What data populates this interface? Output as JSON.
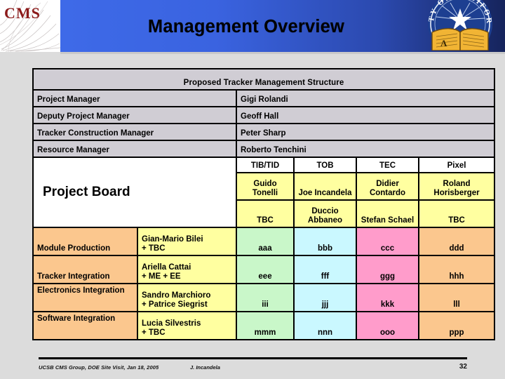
{
  "slide": {
    "title": "Management Overview",
    "logo_left": {
      "icon": "cms-detector-logo",
      "text": "CMS"
    },
    "logo_right": {
      "icon": "university-of-california-seal",
      "text": "TY OF CALIFOR"
    }
  },
  "colors": {
    "banner_start": "#3e6ae8",
    "banner_end": "#16245c",
    "background": "#dcdcdc",
    "cell_grey": "#d0cdd4",
    "cell_white": "#ffffff",
    "cell_yellow": "#ffffa0",
    "cell_orange": "#fbc78e",
    "cell_green": "#c9f7c9",
    "cell_cyan": "#caf8ff",
    "cell_pink": "#ff9ccb",
    "cms_red": "#8b1a1a"
  },
  "table": {
    "title": "Proposed Tracker Management Structure",
    "management_rows": [
      {
        "role": "Project Manager",
        "person": "Gigi Rolandi"
      },
      {
        "role": "Deputy Project Manager",
        "person": "Geoff Hall"
      },
      {
        "role": "Tracker Construction Manager",
        "person": "Peter Sharp"
      },
      {
        "role": "Resource Manager",
        "person": "Roberto Tenchini"
      }
    ],
    "subsystem_headers": [
      "TIB/TID",
      "TOB",
      "TEC",
      "Pixel"
    ],
    "project_board_label": "Project Board",
    "board_row_1": [
      "Guido Tonelli",
      "Joe Incandela",
      "Didier Contardo",
      "Roland Horisberger"
    ],
    "board_row_2": [
      "TBC",
      "Duccio Abbaneo",
      "Stefan Schael",
      "TBC"
    ],
    "activity_rows": [
      {
        "activity": "Module Production",
        "leaders": "Gian-Mario Bilei\n+ TBC",
        "codes": [
          "aaa",
          "bbb",
          "ccc",
          "ddd"
        ]
      },
      {
        "activity": "Tracker Integration",
        "leaders": "Ariella Cattai\n+ ME + EE",
        "codes": [
          "eee",
          "fff",
          "ggg",
          "hhh"
        ]
      },
      {
        "activity": "Electronics Integration",
        "leaders": "Sandro Marchioro\n+ Patrice Siegrist",
        "codes": [
          "iii",
          "jjj",
          "kkk",
          "lll"
        ]
      },
      {
        "activity": "Software Integration",
        "leaders": "Lucia Silvestris\n+ TBC",
        "codes": [
          "mmm",
          "nnn",
          "ooo",
          "ppp"
        ]
      }
    ]
  },
  "footer": {
    "meeting": "UCSB CMS Group, DOE Site Visit, Jan 18, 2005",
    "author": "J. Incandela",
    "page": "32"
  }
}
